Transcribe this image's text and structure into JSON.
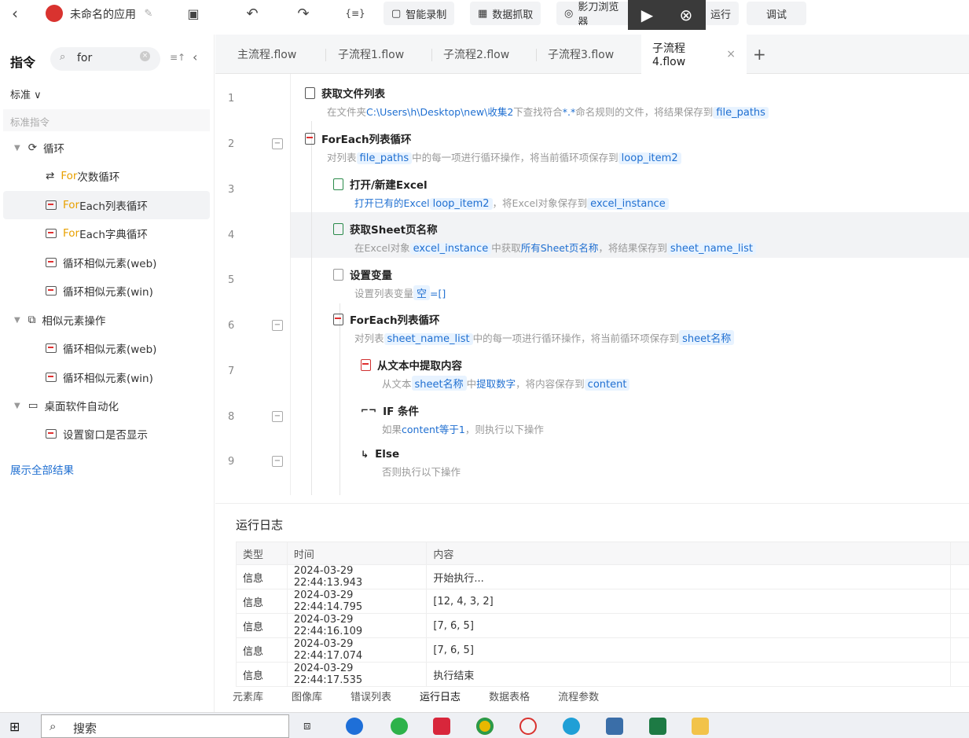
{
  "topbar": {
    "back": "‹",
    "app_name": "未命名的应用",
    "undo": "↶",
    "redo": "↷",
    "braces": "{≡}",
    "buttons": [
      "智能录制",
      "数据抓取",
      "影刀浏览器"
    ],
    "run": "运行",
    "debug": "调试"
  },
  "sidebar": {
    "title": "指令",
    "search_value": "for",
    "mode": "标准 ∨",
    "section": "标准指令",
    "show_all": "展示全部结果",
    "groups": [
      {
        "label": "循环",
        "items": [
          {
            "pre": "For",
            "post": "次数循环"
          },
          {
            "pre": "For",
            "post": "Each列表循环"
          },
          {
            "pre": "For",
            "post": "Each字典循环"
          },
          {
            "pre": "",
            "post": "循环相似元素(web)"
          },
          {
            "pre": "",
            "post": "循环相似元素(win)"
          }
        ]
      },
      {
        "label": "相似元素操作",
        "items": [
          {
            "pre": "",
            "post": "循环相似元素(web)"
          },
          {
            "pre": "",
            "post": "循环相似元素(win)"
          }
        ]
      },
      {
        "label": "桌面软件自动化",
        "items": [
          {
            "pre": "",
            "post": "设置窗口是否显示"
          }
        ]
      }
    ]
  },
  "tabs": [
    "主流程.flow",
    "子流程1.flow",
    "子流程2.flow",
    "子流程3.flow",
    "子流程4.flow"
  ],
  "tab_add": "+",
  "steps": [
    {
      "n": "1",
      "title": "获取文件列表",
      "d1": "在文件夹",
      "p1": "C:\\Users\\h\\Desktop\\new\\收集2",
      "d2": "下查找符合",
      "p2": "*.*",
      "d3": "命名规则的文件，将结果保存到",
      "v1": "file_paths"
    },
    {
      "n": "2",
      "title": "ForEach列表循环",
      "d1": "对列表",
      "v1": "file_paths",
      "d2": "中的每一项进行循环操作，将当前循环项保存到",
      "v2": "loop_item2"
    },
    {
      "n": "3",
      "title": "打开/新建Excel",
      "p1": "打开已有的Excel",
      "v1": "loop_item2",
      "d1": "，将Excel对象保存到",
      "v2": "excel_instance"
    },
    {
      "n": "4",
      "title": "获取Sheet页名称",
      "d1": "在Excel对象",
      "v1": "excel_instance",
      "d2": "中获取",
      "p1": "所有Sheet页名称",
      "d3": "，将结果保存到",
      "v2": "sheet_name_list"
    },
    {
      "n": "5",
      "title": "设置变量",
      "d1": "设置列表变量",
      "v1": "空",
      "d2": "=[]"
    },
    {
      "n": "6",
      "title": "ForEach列表循环",
      "d1": "对列表",
      "v1": "sheet_name_list",
      "d2": "中的每一项进行循环操作，将当前循环项保存到",
      "v2": "sheet名称"
    },
    {
      "n": "7",
      "title": "从文本中提取内容",
      "d1": "从文本",
      "v1": "sheet名称",
      "d2": "中",
      "p1": "提取数字",
      "d3": "，将内容保存到",
      "v2": "content"
    },
    {
      "n": "8",
      "title": "IF 条件",
      "d1": "如果",
      "p1": "content等于1",
      "d2": "，则执行以下操作"
    },
    {
      "n": "9",
      "title": "Else",
      "d1": "否则执行以下操作"
    }
  ],
  "log": {
    "title": "运行日志",
    "headers": [
      "类型",
      "时间",
      "内容"
    ],
    "rows": [
      [
        "信息",
        "2024-03-29 22:44:13.943",
        "开始执行..."
      ],
      [
        "信息",
        "2024-03-29 22:44:14.795",
        "[12, 4, 3, 2]"
      ],
      [
        "信息",
        "2024-03-29 22:44:16.109",
        "[7, 6, 5]"
      ],
      [
        "信息",
        "2024-03-29 22:44:17.074",
        "[7, 6, 5]"
      ],
      [
        "信息",
        "2024-03-29 22:44:17.535",
        "执行结束"
      ]
    ]
  },
  "bottom_tabs": [
    "元素库",
    "图像库",
    "错误列表",
    "运行日志",
    "数据表格",
    "流程参数"
  ],
  "taskbar": {
    "search": "搜索"
  }
}
